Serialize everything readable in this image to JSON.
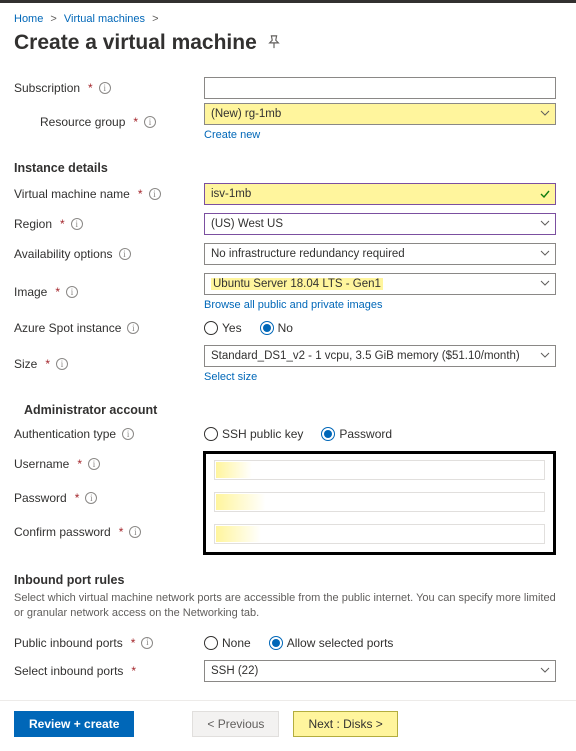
{
  "breadcrumb": {
    "home": "Home",
    "vms": "Virtual machines"
  },
  "title": "Create a virtual machine",
  "subscription_field": {
    "label": "Subscription",
    "value": "",
    "resource_group_label": "Resource group",
    "resource_group_value": "(New) rg-1mb",
    "create_new": "Create new"
  },
  "instance": {
    "heading": "Instance details",
    "vm_name_label": "Virtual machine name",
    "vm_name_value": "isv-1mb",
    "region_label": "Region",
    "region_value": "(US) West US",
    "avail_label": "Availability options",
    "avail_value": "No infrastructure redundancy required",
    "image_label": "Image",
    "image_value": "Ubuntu Server 18.04 LTS - Gen1",
    "browse_images": "Browse all public and private images",
    "spot_label": "Azure Spot instance",
    "spot_yes": "Yes",
    "spot_no": "No",
    "size_label": "Size",
    "size_value": "Standard_DS1_v2 - 1 vcpu, 3.5 GiB memory ($51.10/month)",
    "select_size": "Select size"
  },
  "admin": {
    "heading": "Administrator account",
    "auth_label": "Authentication type",
    "auth_ssh": "SSH public key",
    "auth_pwd": "Password",
    "username_label": "Username",
    "password_label": "Password",
    "confirm_label": "Confirm password"
  },
  "inbound": {
    "heading": "Inbound port rules",
    "text": "Select which virtual machine network ports are accessible from the public internet. You can specify more limited or granular network access on the Networking tab.",
    "public_label": "Public inbound ports",
    "opt_none": "None",
    "opt_allow": "Allow selected ports",
    "select_label": "Select inbound ports",
    "select_value": "SSH (22)"
  },
  "footer": {
    "review": "Review + create",
    "previous": "< Previous",
    "next": "Next : Disks >"
  }
}
